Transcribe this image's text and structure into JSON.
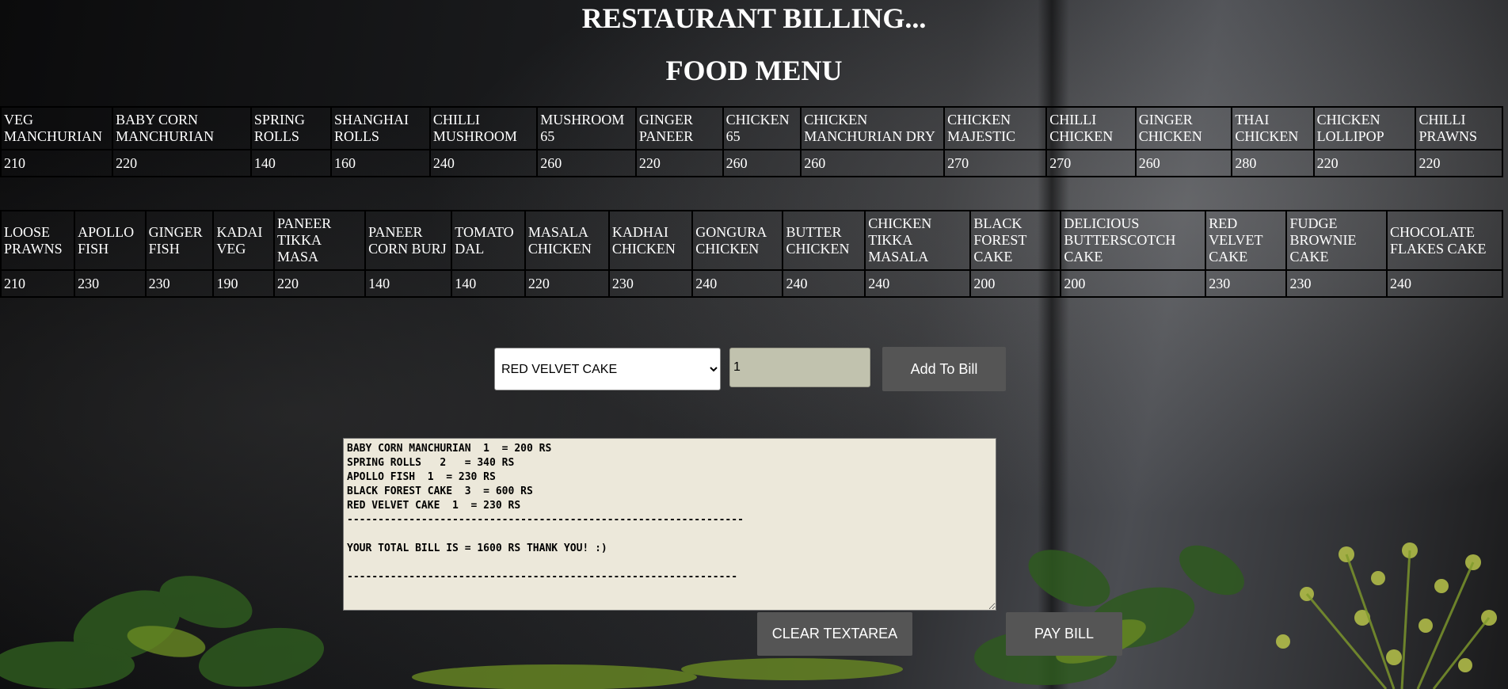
{
  "header": {
    "title": "RESTAURANT BILLING...",
    "subtitle": "FOOD MENU"
  },
  "menu_rows": [
    [
      {
        "name": "VEG MANCHURIAN",
        "price": "210"
      },
      {
        "name": "BABY CORN MANCHURIAN",
        "price": "220"
      },
      {
        "name": "SPRING ROLLS",
        "price": "140"
      },
      {
        "name": "SHANGHAI ROLLS",
        "price": "160"
      },
      {
        "name": "CHILLI MUSHROOM",
        "price": "240"
      },
      {
        "name": "MUSHROOM 65",
        "price": "260"
      },
      {
        "name": "GINGER PANEER",
        "price": "220"
      },
      {
        "name": "CHICKEN 65",
        "price": "260"
      },
      {
        "name": "CHICKEN MANCHURIAN DRY",
        "price": "260"
      },
      {
        "name": "CHICKEN MAJESTIC",
        "price": "270"
      },
      {
        "name": "CHILLI CHICKEN",
        "price": "270"
      },
      {
        "name": "GINGER CHICKEN",
        "price": "260"
      },
      {
        "name": "THAI CHICKEN",
        "price": "280"
      },
      {
        "name": "CHICKEN LOLLIPOP",
        "price": "220"
      },
      {
        "name": "CHILLI PRAWNS",
        "price": "220"
      }
    ],
    [
      {
        "name": "LOOSE PRAWNS",
        "price": "210"
      },
      {
        "name": "APOLLO FISH",
        "price": "230"
      },
      {
        "name": "GINGER FISH",
        "price": "230"
      },
      {
        "name": "KADAI VEG",
        "price": "190"
      },
      {
        "name": "PANEER TIKKA MASA",
        "price": "220"
      },
      {
        "name": "PANEER CORN BURJ",
        "price": "140"
      },
      {
        "name": "TOMATO DAL",
        "price": "140"
      },
      {
        "name": "MASALA CHICKEN",
        "price": "220"
      },
      {
        "name": "KADHAI CHICKEN",
        "price": "230"
      },
      {
        "name": "GONGURA CHICKEN",
        "price": "240"
      },
      {
        "name": "BUTTER CHICKEN",
        "price": "240"
      },
      {
        "name": "CHICKEN TIKKA MASALA",
        "price": "240"
      },
      {
        "name": "BLACK FOREST CAKE",
        "price": "200"
      },
      {
        "name": "DELICIOUS BUTTERSCOTCH CAKE",
        "price": "200"
      },
      {
        "name": "RED VELVET CAKE",
        "price": "230"
      },
      {
        "name": "FUDGE BROWNIE CAKE",
        "price": "230"
      },
      {
        "name": "CHOCOLATE FLAKES CAKE",
        "price": "240"
      }
    ]
  ],
  "order": {
    "selected_dish": "RED VELVET CAKE",
    "quantity": "1",
    "add_label": "Add To Bill"
  },
  "bill": {
    "text": "BABY CORN MANCHURIAN  1  = 200 RS\nSPRING ROLLS   2   = 340 RS\nAPOLLO FISH  1  = 230 RS\nBLACK FOREST CAKE  3  = 600 RS\nRED VELVET CAKE  1  = 230 RS\n----------------------------------------------------------------\n\nYOUR TOTAL BILL IS = 1600 RS THANK YOU! :)\n\n---------------------------------------------------------------"
  },
  "actions": {
    "clear_label": "CLEAR TEXTAREA",
    "pay_label": "PAY BILL"
  }
}
